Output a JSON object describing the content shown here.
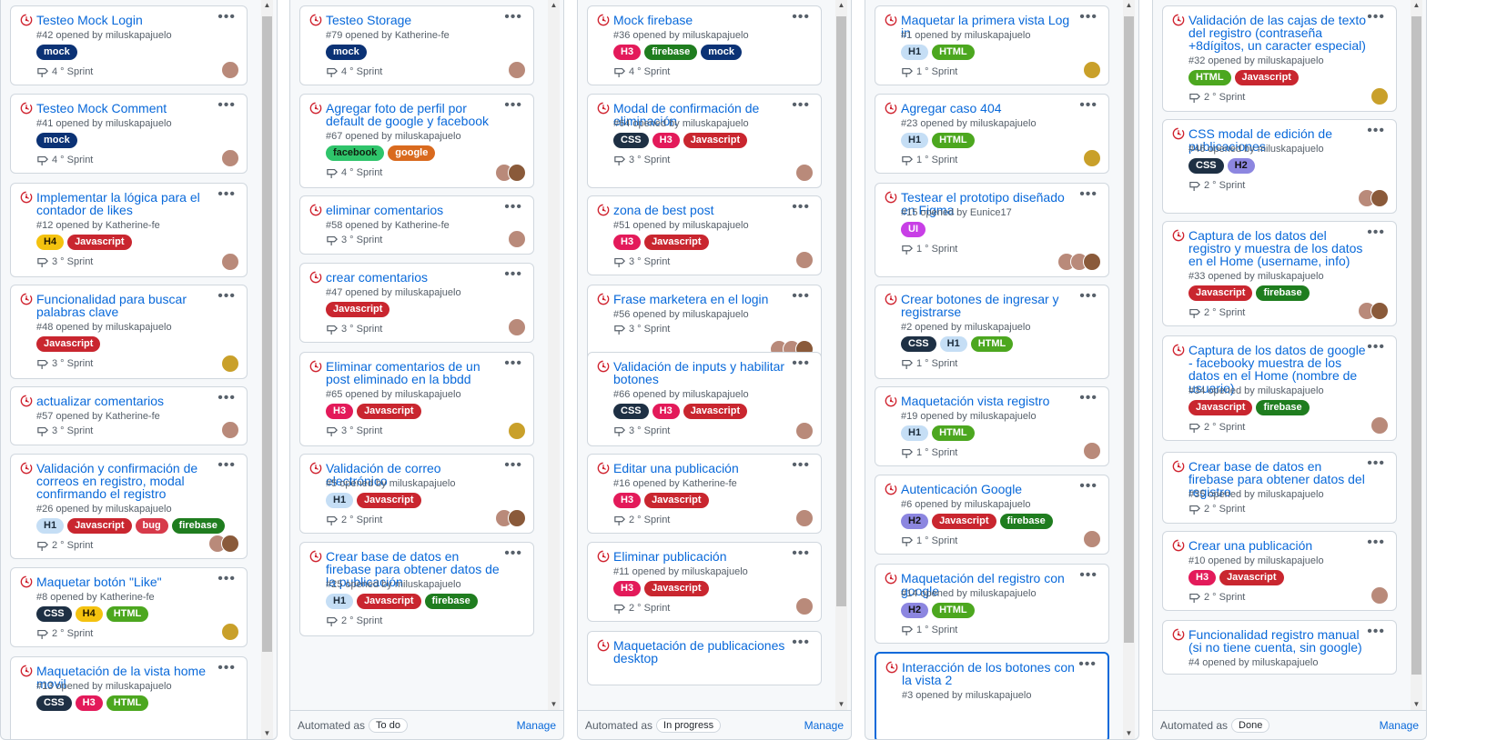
{
  "labels": {
    "mock": {
      "bg": "#0b3275",
      "fg": "#ffffff"
    },
    "firebase": {
      "bg": "#1f7d1f",
      "fg": "#ffffff"
    },
    "facebook": {
      "bg": "#2fc46b",
      "fg": "#102010"
    },
    "google": {
      "bg": "#d96a1e",
      "fg": "#ffffff"
    },
    "H1": {
      "bg": "#c5def5",
      "fg": "#1b2b3a"
    },
    "H2": {
      "bg": "#8c86e0",
      "fg": "#111111"
    },
    "H3": {
      "bg": "#e31a5a",
      "fg": "#ffffff"
    },
    "H4": {
      "bg": "#f4c20f",
      "fg": "#201800"
    },
    "HTML": {
      "bg": "#4ca71f",
      "fg": "#ffffff"
    },
    "CSS": {
      "bg": "#1e3044",
      "fg": "#ffffff"
    },
    "Javascript": {
      "bg": "#c9262f",
      "fg": "#ffffff"
    },
    "bug": {
      "bg": "#d73a4a",
      "fg": "#ffffff"
    },
    "UI": {
      "bg": "#c83fe6",
      "fg": "#ffffff"
    }
  },
  "columns": [
    {
      "footer": null,
      "cards": [
        {
          "title": "Testeo Mock Login",
          "meta": "#42 opened by miluskapajuelo",
          "labels": [
            "mock"
          ],
          "milestone": "4 ° Sprint",
          "avatars": [
            "a"
          ]
        },
        {
          "title": "Testeo Mock Comment",
          "meta": "#41 opened by miluskapajuelo",
          "labels": [
            "mock"
          ],
          "milestone": "4 ° Sprint",
          "avatars": [
            "a"
          ]
        },
        {
          "title": "Implementar la lógica para el contador de likes",
          "meta": "#12 opened by Katherine-fe",
          "labels": [
            "H4",
            "Javascript"
          ],
          "milestone": "3 ° Sprint",
          "avatars": [
            "a"
          ]
        },
        {
          "title": "Funcionalidad para buscar palabras clave",
          "meta": "#48 opened by miluskapajuelo",
          "labels": [
            "Javascript"
          ],
          "milestone": "3 ° Sprint",
          "avatars": [
            "b"
          ]
        },
        {
          "title": "actualizar comentarios",
          "meta": "#57 opened by Katherine-fe",
          "labels": [],
          "milestone": "3 ° Sprint",
          "avatars": [
            "a"
          ]
        },
        {
          "title": "Validación y confirmación de correos en registro, modal confirmando el registro",
          "meta": "#26 opened by miluskapajuelo",
          "labels": [
            "H1",
            "Javascript",
            "bug",
            "firebase"
          ],
          "milestone": "2 ° Sprint",
          "avatars": [
            "a",
            "c"
          ]
        },
        {
          "title": "Maquetar botón \"Like\"",
          "meta": "#8 opened by Katherine-fe",
          "labels": [
            "CSS",
            "H4",
            "HTML"
          ],
          "milestone": "2 ° Sprint",
          "avatars": [
            "b"
          ]
        },
        {
          "title": "Maquetación de la vista home movil",
          "meta": "#13 opened by miluskapajuelo",
          "labels": [
            "CSS",
            "H3",
            "HTML"
          ],
          "milestone": "",
          "avatars": []
        }
      ]
    },
    {
      "footer": {
        "automated": "Automated as",
        "state": "To do",
        "manage": "Manage"
      },
      "cards": [
        {
          "title": "Testeo Storage",
          "meta": "#79 opened by Katherine-fe",
          "labels": [
            "mock"
          ],
          "milestone": "4 ° Sprint",
          "avatars": [
            "a"
          ]
        },
        {
          "title": "Agregar foto de perfil por default de google y facebook",
          "meta": "#67 opened by miluskapajuelo",
          "labels": [
            "facebook",
            "google"
          ],
          "milestone": "4 ° Sprint",
          "avatars": [
            "a",
            "c"
          ]
        },
        {
          "title": "eliminar comentarios",
          "meta": "#58 opened by Katherine-fe",
          "labels": [],
          "milestone": "3 ° Sprint",
          "avatars": [
            "a"
          ]
        },
        {
          "title": "crear comentarios",
          "meta": "#47 opened by miluskapajuelo",
          "labels": [
            "Javascript"
          ],
          "milestone": "3 ° Sprint",
          "avatars": [
            "a"
          ]
        },
        {
          "title": "Eliminar comentarios de un post eliminado en la bbdd",
          "meta": "#65 opened by miluskapajuelo",
          "labels": [
            "H3",
            "Javascript"
          ],
          "milestone": "3 ° Sprint",
          "avatars": [
            "b"
          ]
        },
        {
          "title": "Validación de correo electrónico",
          "meta": "#5 opened by miluskapajuelo",
          "labels": [
            "H1",
            "Javascript"
          ],
          "milestone": "2 ° Sprint",
          "avatars": [
            "a",
            "c"
          ]
        },
        {
          "title": "Crear base de datos en firebase para obtener datos de la publicación",
          "meta": "#25 opened by miluskapajuelo",
          "labels": [
            "H1",
            "Javascript",
            "firebase"
          ],
          "milestone": "2 ° Sprint",
          "avatars": []
        }
      ]
    },
    {
      "footer": {
        "automated": "Automated as",
        "state": "In progress",
        "manage": "Manage"
      },
      "cards": [
        {
          "title": "Mock firebase",
          "meta": "#36 opened by miluskapajuelo",
          "labels": [
            "H3",
            "firebase",
            "mock"
          ],
          "milestone": "4 ° Sprint",
          "avatars": []
        },
        {
          "title": "Modal de confirmación de eliminación",
          "meta": "#64 opened by miluskapajuelo",
          "labels": [
            "CSS",
            "H3",
            "Javascript"
          ],
          "milestone": "3 ° Sprint",
          "avatars": [
            "a"
          ]
        },
        {
          "title": "zona de best post",
          "meta": "#51 opened by miluskapajuelo",
          "labels": [
            "H3",
            "Javascript"
          ],
          "milestone": "3 ° Sprint",
          "avatars": [
            "a"
          ]
        },
        {
          "title": "Frase marketera en el login",
          "meta": "#56 opened by miluskapajuelo",
          "labels": [],
          "milestone": "3 ° Sprint",
          "avatars": [
            "a",
            "a",
            "c"
          ]
        },
        {
          "title": "Validación de inputs y habilitar botones",
          "meta": "#66 opened by miluskapajuelo",
          "labels": [
            "CSS",
            "H3",
            "Javascript"
          ],
          "milestone": "3 ° Sprint",
          "avatars": [
            "a"
          ]
        },
        {
          "title": "Editar una publicación",
          "meta": "#16 opened by Katherine-fe",
          "labels": [
            "H3",
            "Javascript"
          ],
          "milestone": "2 ° Sprint",
          "avatars": [
            "a"
          ]
        },
        {
          "title": "Eliminar publicación",
          "meta": "#11 opened by miluskapajuelo",
          "labels": [
            "H3",
            "Javascript"
          ],
          "milestone": "2 ° Sprint",
          "avatars": [
            "a"
          ]
        },
        {
          "title": "Maquetación de publicaciones desktop",
          "meta": "",
          "labels": [],
          "milestone": "",
          "avatars": []
        }
      ]
    },
    {
      "footer": null,
      "cards": [
        {
          "title": "Maquetar la primera vista Log in",
          "meta": "#1 opened by miluskapajuelo",
          "labels": [
            "H1",
            "HTML"
          ],
          "milestone": "1 ° Sprint",
          "avatars": [
            "b"
          ]
        },
        {
          "title": "Agregar caso 404",
          "meta": "#23 opened by miluskapajuelo",
          "labels": [
            "H1",
            "HTML"
          ],
          "milestone": "1 ° Sprint",
          "avatars": [
            "b"
          ]
        },
        {
          "title": "Testear el prototipo diseñado en Figma",
          "meta": "#15 opened by Eunice17",
          "labels": [
            "UI"
          ],
          "milestone": "1 ° Sprint",
          "avatars": [
            "a",
            "a",
            "c"
          ]
        },
        {
          "title": "Crear botones de ingresar y registrarse",
          "meta": "#2 opened by miluskapajuelo",
          "labels": [
            "CSS",
            "H1",
            "HTML"
          ],
          "milestone": "1 ° Sprint",
          "avatars": []
        },
        {
          "title": "Maquetación vista registro",
          "meta": "#19 opened by miluskapajuelo",
          "labels": [
            "H1",
            "HTML"
          ],
          "milestone": "1 ° Sprint",
          "avatars": [
            "a"
          ]
        },
        {
          "title": "Autenticación Google",
          "meta": "#6 opened by miluskapajuelo",
          "labels": [
            "H2",
            "Javascript",
            "firebase"
          ],
          "milestone": "1 ° Sprint",
          "avatars": [
            "a"
          ]
        },
        {
          "title": "Maquetación del registro con google",
          "meta": "#14 opened by miluskapajuelo",
          "labels": [
            "H2",
            "HTML"
          ],
          "milestone": "1 ° Sprint",
          "avatars": []
        },
        {
          "title": "Interacción de los botones con la vista 2",
          "meta": "#3 opened by miluskapajuelo",
          "labels": [],
          "milestone": "",
          "avatars": []
        }
      ]
    },
    {
      "footer": {
        "automated": "Automated as",
        "state": "Done",
        "manage": "Manage"
      },
      "cards": [
        {
          "title": "Validación de las cajas de texto del registro (contraseña +8dígitos, un caracter especial)",
          "meta": "#32 opened by miluskapajuelo",
          "labels": [
            "HTML",
            "Javascript"
          ],
          "milestone": "2 ° Sprint",
          "avatars": [
            "b"
          ]
        },
        {
          "title": "CSS modal de edición de publicaciones",
          "meta": "#46 opened by miluskapajuelo",
          "labels": [
            "CSS",
            "H2"
          ],
          "milestone": "2 ° Sprint",
          "avatars": [
            "a",
            "c"
          ]
        },
        {
          "title": "Captura de los datos del registro y muestra de los datos en el Home (username, info)",
          "meta": "#33 opened by miluskapajuelo",
          "labels": [
            "Javascript",
            "firebase"
          ],
          "milestone": "2 ° Sprint",
          "avatars": [
            "a",
            "c"
          ]
        },
        {
          "title": "Captura de los datos de google - facebooky muestra de los datos en el Home (nombre de usuario)",
          "meta": "#34 opened by miluskapajuelo",
          "labels": [
            "Javascript",
            "firebase"
          ],
          "milestone": "2 ° Sprint",
          "avatars": [
            "a"
          ]
        },
        {
          "title": "Crear base de datos en firebase para obtener datos del registro",
          "meta": "#35 opened by miluskapajuelo",
          "labels": [],
          "milestone": "2 ° Sprint",
          "avatars": []
        },
        {
          "title": "Crear una publicación",
          "meta": "#10 opened by miluskapajuelo",
          "labels": [
            "H3",
            "Javascript"
          ],
          "milestone": "2 ° Sprint",
          "avatars": [
            "a"
          ]
        },
        {
          "title": "Funcionalidad registro manual (si no tiene cuenta, sin google)",
          "meta": "#4 opened by miluskapajuelo",
          "labels": [],
          "milestone": "",
          "avatars": []
        }
      ]
    }
  ]
}
